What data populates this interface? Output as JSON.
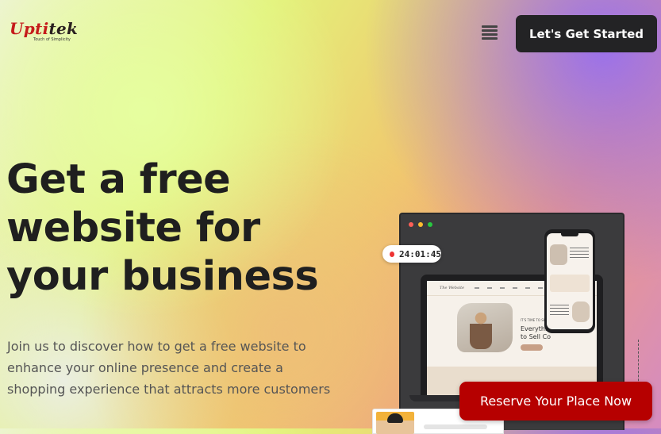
{
  "header": {
    "logo_part1": "Upti",
    "logo_part2": "tek",
    "logo_tagline": "Touch of Simplicity",
    "menu_icon": "hamburger-menu-icon",
    "cta_label": "Let's Get Started"
  },
  "hero": {
    "headline_lines": [
      "Get a free",
      "website for",
      "your business"
    ],
    "subtext_lines": [
      "Join us to discover how to get a free website to",
      "enhance your online presence and create a",
      "shopping experience that attracts more customers"
    ]
  },
  "mockup": {
    "timer": "24:01:45",
    "site_tag": "IT'S TIME TO SHOW",
    "site_headline_1": "Everything",
    "site_headline_2": "to Sell Co",
    "window_dot_colors": [
      "#ff5f57",
      "#febc2e",
      "#28c840"
    ]
  },
  "floating_cta": {
    "label": "Reserve Your Place Now"
  },
  "colors": {
    "brand_red": "#c51b1b",
    "cta_dark": "#232325",
    "cta_red": "#b60000"
  }
}
